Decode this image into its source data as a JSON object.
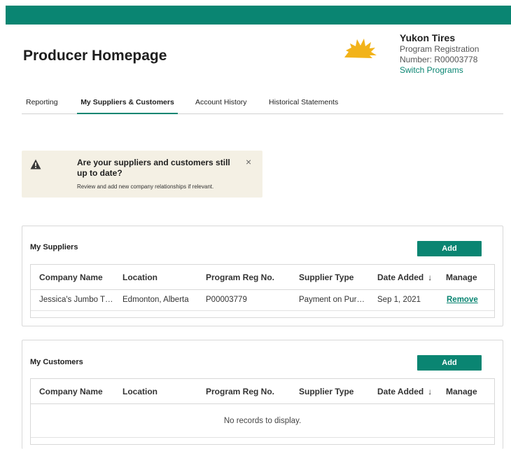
{
  "header": {
    "page_title": "Producer Homepage",
    "logo_icon": "sun-logo-icon",
    "account_name": "Yukon Tires",
    "account_line1": "Program Registration",
    "account_line2": "Number: R00003778",
    "switch_programs": "Switch Programs"
  },
  "tabs": [
    {
      "label": "Reporting",
      "active": false
    },
    {
      "label": "My Suppliers & Customers",
      "active": true
    },
    {
      "label": "Account History",
      "active": false
    },
    {
      "label": "Historical Statements",
      "active": false
    }
  ],
  "alert": {
    "icon": "warning-icon",
    "title": "Are your suppliers and customers still up to date?",
    "subtitle": "Review and add new company relationships if relevant.",
    "close": "×"
  },
  "suppliers": {
    "title": "My Suppliers",
    "add_label": "Add",
    "columns": [
      "Company Name",
      "Location",
      "Program Reg No.",
      "Supplier Type",
      "Date Added",
      "Manage"
    ],
    "sort_indicator": "↓",
    "rows": [
      {
        "company": "Jessica's Jumbo T…",
        "location": "Edmonton, Alberta",
        "reg_no": "P00003779",
        "supplier_type": "Payment on Pur…",
        "date_added": "Sep 1, 2021",
        "manage": "Remove"
      }
    ]
  },
  "customers": {
    "title": "My Customers",
    "add_label": "Add",
    "columns": [
      "Company Name",
      "Location",
      "Program Reg No.",
      "Supplier Type",
      "Date Added",
      "Manage"
    ],
    "sort_indicator": "↓",
    "empty_message": "No records to display."
  },
  "colors": {
    "brand": "#0a8572",
    "alert_bg": "#f4f0e4",
    "logo": "#f2b31a"
  }
}
